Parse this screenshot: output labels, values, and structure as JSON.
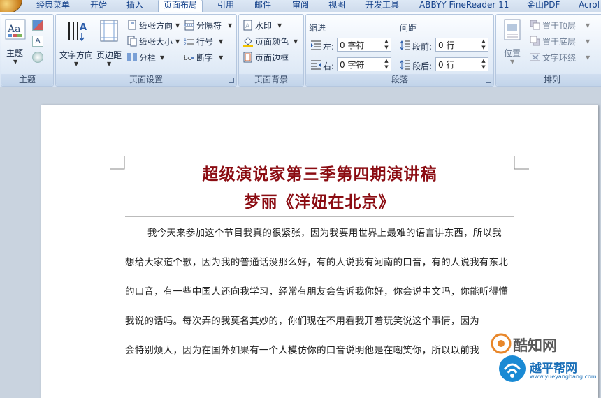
{
  "tabs": [
    "经典菜单",
    "开始",
    "插入",
    "页面布局",
    "引用",
    "邮件",
    "审阅",
    "视图",
    "开发工具",
    "ABBYY FineReader 11",
    "金山PDF",
    "Acrol"
  ],
  "active_tab": "页面布局",
  "ribbon": {
    "theme_group": {
      "label": "主题",
      "theme_button": "主题"
    },
    "page_setup": {
      "label": "页面设置",
      "text_direction": "文字方向",
      "margins": "页边距",
      "orientation": "纸张方向",
      "size": "纸张大小",
      "columns": "分栏",
      "breaks": "分隔符",
      "line_numbers": "行号",
      "hyphenation": "断字"
    },
    "page_background": {
      "label": "页面背景",
      "watermark": "水印",
      "page_color": "页面颜色",
      "page_borders": "页面边框"
    },
    "paragraph": {
      "label": "段落",
      "indent_title": "缩进",
      "spacing_title": "间距",
      "left_label": "左:",
      "left_value": "0 字符",
      "right_label": "右:",
      "right_value": "0 字符",
      "before_label": "段前:",
      "before_value": "0 行",
      "after_label": "段后:",
      "after_value": "0 行"
    },
    "arrange": {
      "label": "排列",
      "position": "位置",
      "bring_front": "置于顶层",
      "send_back": "置于底层",
      "text_wrap": "文字环绕"
    }
  },
  "document": {
    "title1": "超级演说家第三季第四期演讲稿",
    "title2": "梦丽《洋妞在北京》",
    "lines": [
      "我今天来参加这个节目我真的很紧张，因为我要用世界上最难的语言讲东西，所以我",
      "想给大家道个歉，因为我的普通话没那么好，有的人说我有河南的口音，有的人说我有东北",
      "的口音，有一些中国人还向我学习，经常有朋友会告诉我你好，你会说中文吗，你能听得懂",
      "我说的话吗。每次弄的我莫名其妙的，你们现在不用看我开着玩笑说这个事情，因为",
      "会特别烦人，因为在国外如果有一个人模仿你的口音说明他是在嘲笑你，所以以前我"
    ]
  },
  "watermarks": {
    "w1": "酷知网",
    "w2": "越平帮网",
    "w2_url": "www.yueyangbang.com"
  }
}
